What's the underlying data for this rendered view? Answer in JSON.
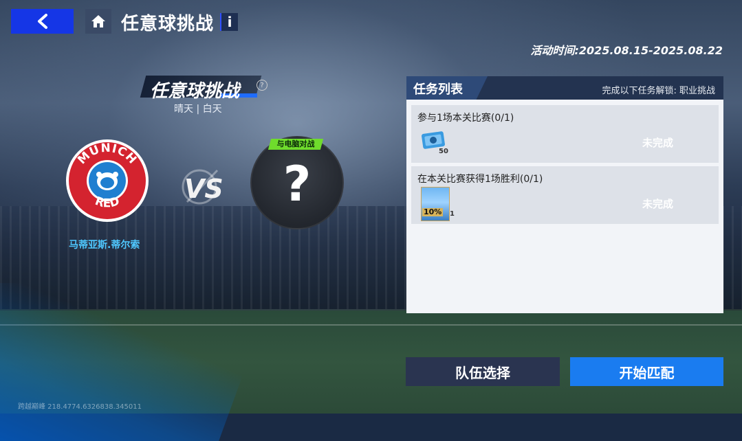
{
  "header": {
    "title": "任意球挑战",
    "event_time": "活动时间:2025.08.15-2025.08.22"
  },
  "mode": {
    "title": "任意球挑战",
    "weather": "晴天 | 白天"
  },
  "match": {
    "team_name": "马蒂亚斯.蒂尔索",
    "team_logo_text_top": "MUNICH",
    "team_logo_text_bottom": "RED",
    "vs": "VS",
    "opponent_tag": "与电脑对战",
    "opponent_placeholder": "?"
  },
  "tasks": {
    "title": "任务列表",
    "note": "完成以下任务解锁: 职业挑战",
    "items": [
      {
        "desc": "参与1场本关比赛(0/1)",
        "reward_qty": "50",
        "status": "未完成"
      },
      {
        "desc": "在本关比赛获得1场胜利(0/1)",
        "reward_tag": "10%",
        "reward_qty": "1",
        "status": "未完成"
      }
    ]
  },
  "buttons": {
    "team_select": "队伍选择",
    "start_match": "开始匹配"
  },
  "footer": {
    "server_info": "跨越巅峰 218.4774.6326838.345011"
  },
  "colors": {
    "accent_blue": "#1536e6",
    "start_button": "#1a7cf0",
    "team_name": "#4fc8ff",
    "cpu_tag": "#6fdc2c"
  }
}
